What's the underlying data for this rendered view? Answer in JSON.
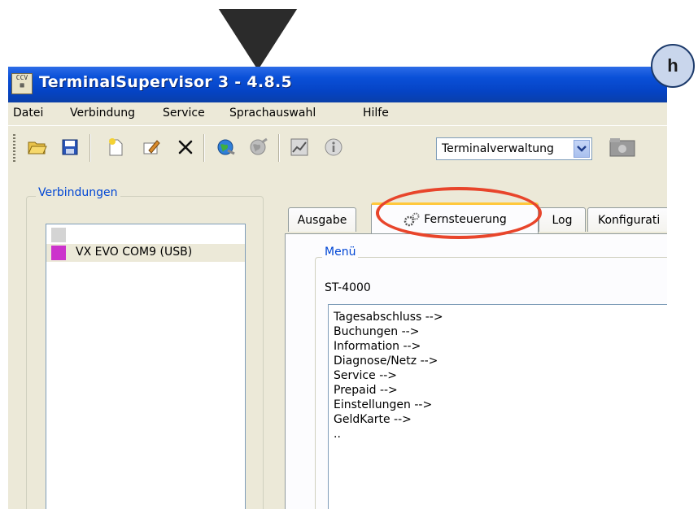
{
  "window": {
    "title": "TerminalSupervisor 3 - 4.8.5",
    "app_icon_text": "CCV"
  },
  "menubar": {
    "items": [
      "Datei",
      "Verbindung",
      "Service",
      "Sprachauswahl",
      "Hilfe"
    ]
  },
  "toolbar": {
    "icons": [
      "open-folder-icon",
      "save-icon",
      "new-icon",
      "edit-icon",
      "delete-icon",
      "connect-globe-icon",
      "disconnect-globe-icon",
      "chart-icon",
      "info-icon",
      "terminal-folder-icon"
    ],
    "terminal_select": {
      "value": "Terminalverwaltung"
    }
  },
  "connections": {
    "group_label": "Verbindungen",
    "items": [
      {
        "label": "",
        "color": "#d4d4d4"
      },
      {
        "label": "VX EVO COM9 (USB)",
        "color": "#cc33cc"
      }
    ]
  },
  "tabs": [
    {
      "label": "Ausgabe",
      "active": false
    },
    {
      "label": "Fernsteuerung",
      "active": true
    },
    {
      "label": "Log",
      "active": false
    },
    {
      "label": "Konfigurati",
      "active": false
    }
  ],
  "remote_control": {
    "group_label": "Menü",
    "terminal_model": "ST-4000",
    "menu_entries": [
      "Tagesabschluss -->",
      "Buchungen -->",
      "Information -->",
      "Diagnose/Netz -->",
      "Service -->",
      "Prepaid -->",
      "Einstellungen -->",
      "GeldKarte -->",
      ".."
    ]
  },
  "annotations": {
    "badge_letter": "h",
    "highlight_color": "#e8452b",
    "marker_color": "#2b2b2b"
  }
}
